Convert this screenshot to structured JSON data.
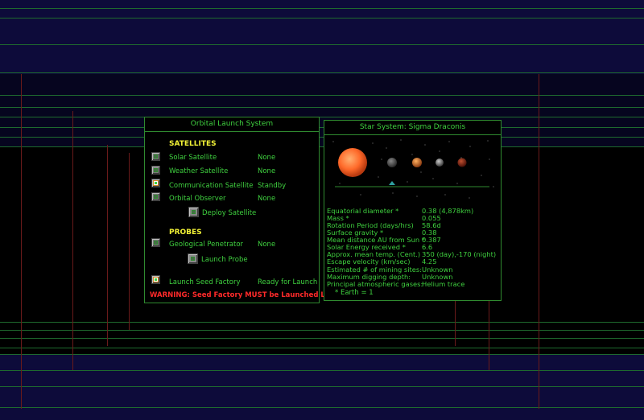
{
  "launch_panel": {
    "title": "Orbital Launch System",
    "satellites_heading": "SATELLITES",
    "satellites": [
      {
        "label": "Solar Satellite",
        "status": "None",
        "selected": false
      },
      {
        "label": "Weather Satellite",
        "status": "None",
        "selected": false
      },
      {
        "label": "Communication Satellite",
        "status": "Standby",
        "selected": true
      },
      {
        "label": "Orbital Observer",
        "status": "None",
        "selected": false
      }
    ],
    "deploy_label": "Deploy Satellite",
    "probes_heading": "PROBES",
    "probes": [
      {
        "label": "Geological Penetrator",
        "status": "None",
        "selected": false
      }
    ],
    "launch_probe_label": "Launch Probe",
    "seed_factory": {
      "label": "Launch Seed Factory",
      "status": "Ready for Launch",
      "selected": true
    },
    "warning": "WARNING: Seed Factory MUST be Launched Last!"
  },
  "star_panel": {
    "title": "Star System: Sigma Draconis",
    "planets": [
      {
        "name": "star",
        "color": "#ff6a2a"
      },
      {
        "name": "planet-1",
        "color": "#4a4a4a"
      },
      {
        "name": "planet-2",
        "color": "#d0702a"
      },
      {
        "name": "planet-3",
        "color": "#7a7a7a"
      },
      {
        "name": "planet-4",
        "color": "#8a2a1a"
      }
    ],
    "stats": [
      {
        "label": "Equatorial diameter *",
        "value": "0.38 (4,878km)"
      },
      {
        "label": "Mass *",
        "value": "0.055"
      },
      {
        "label": "Rotation Period (days/hrs)",
        "value": "58.6d"
      },
      {
        "label": "Surface gravity *",
        "value": "0.38"
      },
      {
        "label": "Mean distance AU from Sun *",
        "value": "0.387"
      },
      {
        "label": "Solar Energy received *",
        "value": "6.6"
      },
      {
        "label": "Approx. mean temp. (Cent.)",
        "value": "350 (day),-170 (night)"
      },
      {
        "label": "Escape velocity (km/sec)",
        "value": "4.25"
      },
      {
        "label": "Estimated # of mining sites:",
        "value": "Unknown"
      },
      {
        "label": "Maximum digging depth:",
        "value": "Unknown"
      },
      {
        "label": "Principal atmospheric gases:",
        "value": "Helium trace"
      }
    ],
    "footnote": "* Earth = 1"
  },
  "colors": {
    "text": "#3fd13f",
    "heading": "#f2f236",
    "warning": "#ff2a2a",
    "border": "#2f8a2f"
  }
}
